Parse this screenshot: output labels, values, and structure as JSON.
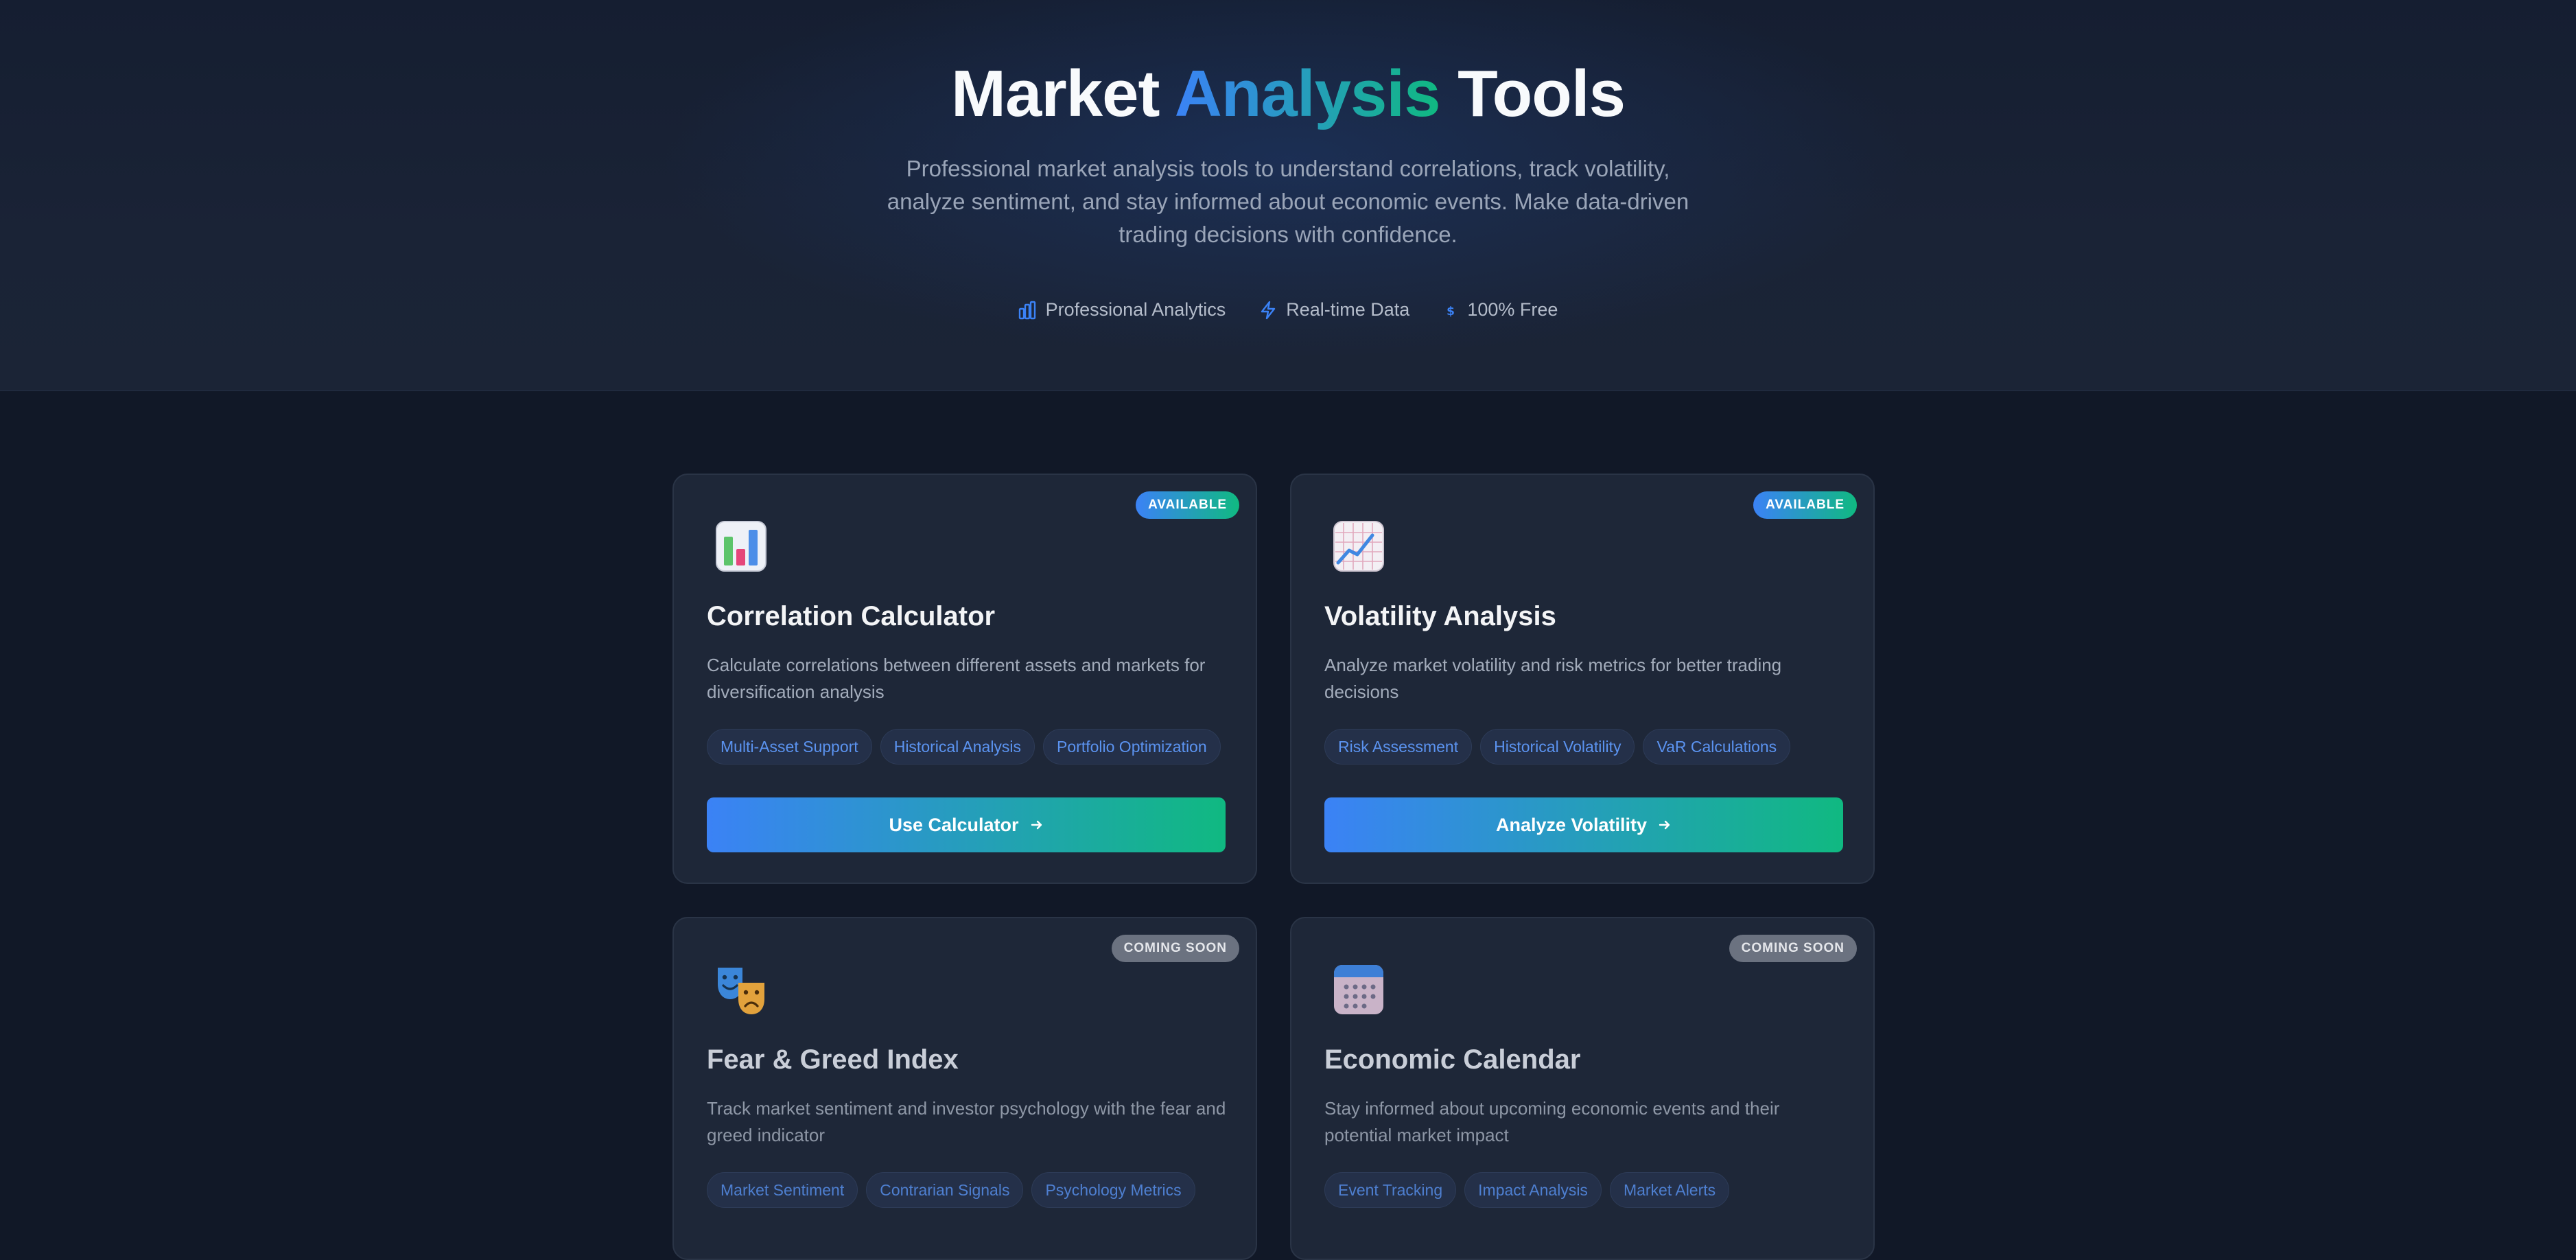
{
  "hero": {
    "title_part1": "Market ",
    "title_accent": "Analysis",
    "title_part2": " Tools",
    "subtitle": "Professional market analysis tools to understand correlations, track volatility, analyze sentiment, and stay informed about economic events. Make data-driven trading decisions with confidence.",
    "features": [
      {
        "label": "Professional Analytics",
        "icon": "bar-chart-icon"
      },
      {
        "label": "Real-time Data",
        "icon": "lightning-icon"
      },
      {
        "label": "100% Free",
        "icon": "dollar-icon"
      }
    ]
  },
  "colors": {
    "accent_blue": "#3b82f6",
    "accent_green": "#10b981",
    "background": "#111827",
    "card": "#1e2738"
  },
  "tools": [
    {
      "badge": "AVAILABLE",
      "icon": "bar-chart-emoji-icon",
      "title": "Correlation Calculator",
      "description": "Calculate correlations between different assets and markets for diversification analysis",
      "tags": [
        "Multi-Asset Support",
        "Historical Analysis",
        "Portfolio Optimization"
      ],
      "cta": "Use Calculator"
    },
    {
      "badge": "AVAILABLE",
      "icon": "trend-chart-emoji-icon",
      "title": "Volatility Analysis",
      "description": "Analyze market volatility and risk metrics for better trading decisions",
      "tags": [
        "Risk Assessment",
        "Historical Volatility",
        "VaR Calculations"
      ],
      "cta": "Analyze Volatility"
    },
    {
      "badge": "COMING SOON",
      "icon": "theater-masks-emoji-icon",
      "title": "Fear & Greed Index",
      "description": "Track market sentiment and investor psychology with the fear and greed indicator",
      "tags": [
        "Market Sentiment",
        "Contrarian Signals",
        "Psychology Metrics"
      ]
    },
    {
      "badge": "COMING SOON",
      "icon": "calendar-emoji-icon",
      "title": "Economic Calendar",
      "description": "Stay informed about upcoming economic events and their potential market impact",
      "tags": [
        "Event Tracking",
        "Impact Analysis",
        "Market Alerts"
      ]
    }
  ]
}
